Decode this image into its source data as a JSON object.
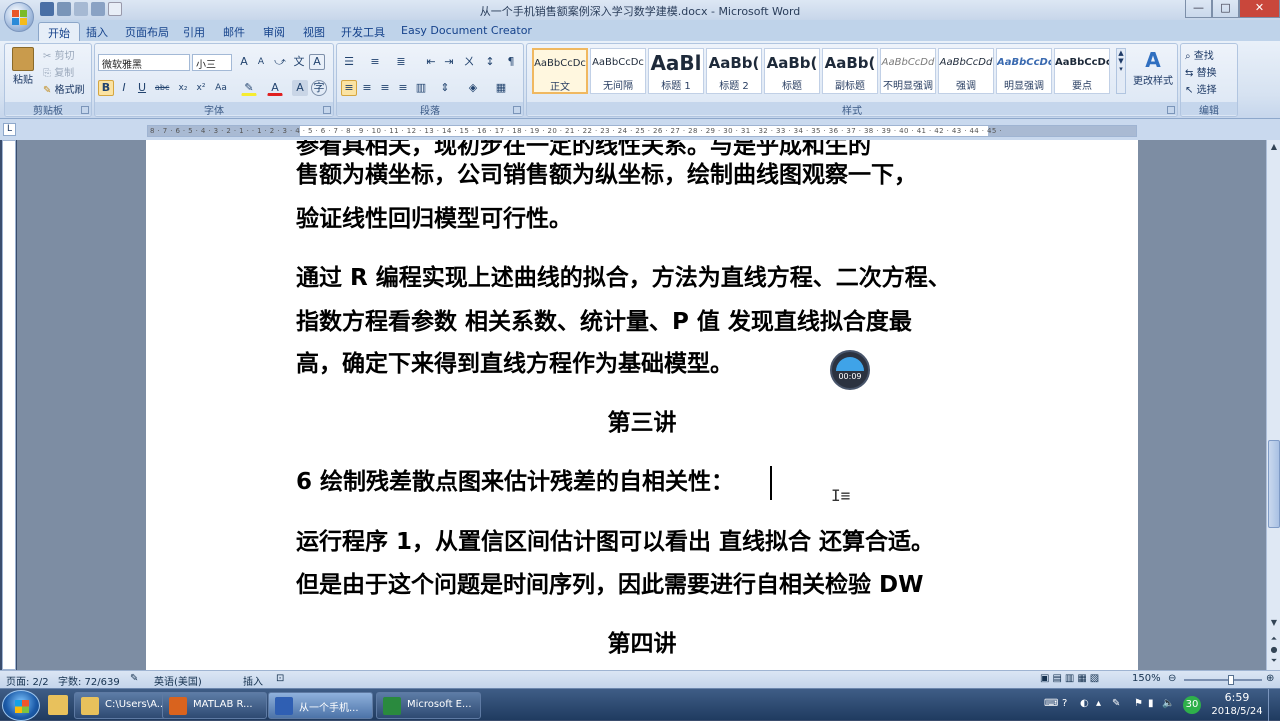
{
  "window": {
    "title": "从一个手机销售额案例深入学习数学建模.docx - Microsoft Word",
    "min": "—",
    "max": "□",
    "close": "✕"
  },
  "tabs": [
    "开始",
    "插入",
    "页面布局",
    "引用",
    "邮件",
    "审阅",
    "视图",
    "开发工具",
    "Easy Document Creator"
  ],
  "clipboard": {
    "paste": "粘贴",
    "cut": "剪切",
    "copy": "复制",
    "format_painter": "格式刷",
    "label": "剪贴板"
  },
  "font": {
    "name": "微软雅黑",
    "size": "小三",
    "label": "字体",
    "grow": "A",
    "shrink": "A",
    "aa": "Aa",
    "bold": "B",
    "italic": "I",
    "underline": "U",
    "strike": "abc",
    "sub": "x₂",
    "sup": "x²",
    "color": "A"
  },
  "paragraph": {
    "label": "段落"
  },
  "styles": {
    "label": "样式",
    "items": [
      {
        "preview": "AaBbCcDc",
        "name": "正文"
      },
      {
        "preview": "AaBbCcDc",
        "name": "无间隔"
      },
      {
        "preview": "AaBl",
        "name": "标题 1"
      },
      {
        "preview": "AaBb(",
        "name": "标题 2"
      },
      {
        "preview": "AaBb(",
        "name": "标题"
      },
      {
        "preview": "AaBb(",
        "name": "副标题"
      },
      {
        "preview": "AaBbCcDd",
        "name": "不明显强调"
      },
      {
        "preview": "AaBbCcDd",
        "name": "强调"
      },
      {
        "preview": "AaBbCcDc",
        "name": "明显强调"
      },
      {
        "preview": "AaBbCcDc",
        "name": "要点"
      }
    ],
    "change": "更改样式"
  },
  "editing": {
    "label": "编辑",
    "find": "查找",
    "replace": "替换",
    "select": "选择"
  },
  "ruler_numbers": "8 · 7 · 6 · 5 · 4 · 3 · 2 · 1 · · 1 · 2 · 3 · 4 · 5 · 6 · 7 · 8 · 9 · 10 · 11 · 12 · 13 · 14 · 15 · 16 · 17 · 18 · 19 · 20 · 21 · 22 · 23 · 24 · 25 · 26 · 27 · 28 · 29 · 30 · 31 · 32 · 33 · 34 · 35 · 36 · 37 · 38 · 39 · 40 · 41 · 42 · 43 · 44 · 45 ·",
  "document": {
    "lines": [
      "售额为横坐标，公司销售额为纵坐标，绘制曲线图观察一下，",
      "验证线性回归模型可行性。",
      "通过  R  编程实现上述曲线的拟合，方法为直线方程、二次方程、",
      "指数方程看参数  相关系数、统计量、P 值   发现直线拟合度最",
      "高，确定下来得到直线方程作为基础模型。",
      "第三讲",
      "6 绘制残差散点图来估计残差的自相关性：",
      "运行程序 1，从置信区间估计图可以看出   直线拟合   还算合适。",
      "但是由于这个问题是时间序列，因此需要进行自相关检验 DW",
      "第四讲"
    ],
    "cut_line": "参看具相关，现初步在一定的线性关系。与是乎成和生的"
  },
  "timer": "00:09",
  "status": {
    "page": "页面: 2/2",
    "words": "字数: 72/639",
    "lang": "英语(美国)",
    "insert": "插入",
    "zoom": "150%"
  },
  "taskbar": {
    "items": [
      "C:\\Users\\A...",
      "MATLAB R...",
      "从一个手机...",
      "Microsoft E..."
    ],
    "time": "6:59",
    "date": "2018/5/24",
    "badge": "30"
  }
}
